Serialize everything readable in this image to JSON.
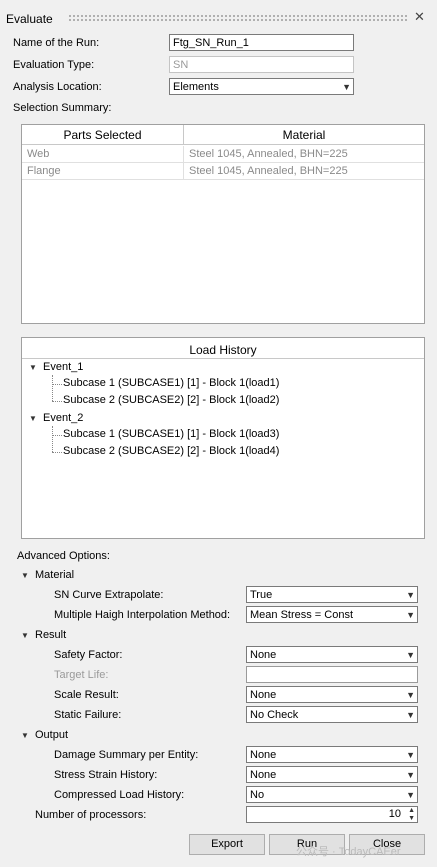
{
  "window": {
    "title": "Evaluate",
    "close_glyph": "✕"
  },
  "form": {
    "run_name_label": "Name of the Run:",
    "run_name_value": "Ftg_SN_Run_1",
    "eval_type_label": "Evaluation Type:",
    "eval_type_value": "SN",
    "analysis_loc_label": "Analysis Location:",
    "analysis_loc_value": "Elements",
    "selection_summary_label": "Selection Summary:"
  },
  "parts_table": {
    "columns": [
      "Parts Selected",
      "Material"
    ],
    "rows": [
      [
        "Web",
        "Steel 1045, Annealed, BHN=225"
      ],
      [
        "Flange",
        "Steel 1045, Annealed, BHN=225"
      ]
    ]
  },
  "load_history": {
    "header": "Load History",
    "events": [
      {
        "label": "Event_1",
        "subcases": [
          "Subcase 1 (SUBCASE1) [1] - Block 1(load1)",
          "Subcase 2 (SUBCASE2) [2] - Block 1(load2)"
        ]
      },
      {
        "label": "Event_2",
        "subcases": [
          "Subcase 1 (SUBCASE1) [1] - Block 1(load3)",
          "Subcase 2 (SUBCASE2) [2] - Block 1(load4)"
        ]
      }
    ]
  },
  "advanced": {
    "label": "Advanced Options:",
    "material": {
      "label": "Material",
      "sn_extrapolate_label": "SN Curve Extrapolate:",
      "sn_extrapolate_value": "True",
      "haigh_label": "Multiple Haigh Interpolation Method:",
      "haigh_value": "Mean Stress = Const"
    },
    "result": {
      "label": "Result",
      "safety_label": "Safety Factor:",
      "safety_value": "None",
      "target_life_label": "Target Life:",
      "target_life_value": "",
      "scale_label": "Scale Result:",
      "scale_value": "None",
      "static_label": "Static Failure:",
      "static_value": "No Check"
    },
    "output": {
      "label": "Output",
      "damage_label": "Damage Summary per Entity:",
      "damage_value": "None",
      "stress_strain_label": "Stress Strain History:",
      "stress_strain_value": "None",
      "compressed_label": "Compressed Load History:",
      "compressed_value": "No"
    },
    "processors_label": "Number of processors:",
    "processors_value": "10"
  },
  "buttons": {
    "export": "Export",
    "run": "Run",
    "close": "Close"
  },
  "watermark": "公众号 · TodayCAEer"
}
